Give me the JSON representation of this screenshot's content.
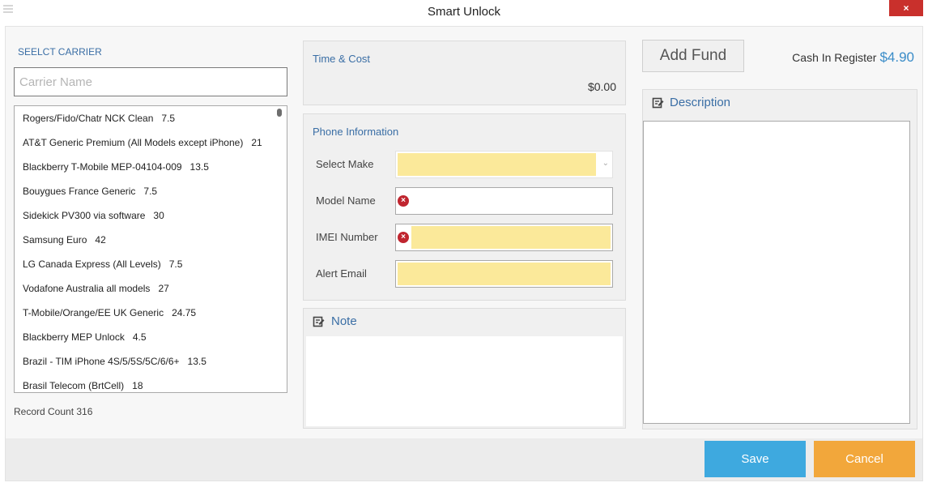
{
  "window": {
    "title": "Smart Unlock",
    "close_label": "×"
  },
  "carrier": {
    "heading": "SEELCT CARRIER",
    "search_placeholder": "Carrier Name",
    "items": [
      {
        "name": "Rogers/Fido/Chatr NCK Clean",
        "price": "7.5"
      },
      {
        "name": "AT&T Generic Premium (All Models except iPhone)",
        "price": "21"
      },
      {
        "name": "Blackberry T-Mobile  MEP-04104-009",
        "price": "13.5"
      },
      {
        "name": "Bouygues France Generic",
        "price": "7.5"
      },
      {
        "name": "Sidekick PV300 via software",
        "price": "30"
      },
      {
        "name": "Samsung Euro",
        "price": "42"
      },
      {
        "name": "LG Canada Express (All Levels)",
        "price": "7.5"
      },
      {
        "name": "Vodafone Australia all models",
        "price": "27"
      },
      {
        "name": "T-Mobile/Orange/EE UK Generic",
        "price": "24.75"
      },
      {
        "name": "Blackberry MEP Unlock",
        "price": "4.5"
      },
      {
        "name": "Brazil - TIM iPhone 4S/5/5S/5C/6/6+",
        "price": "13.5"
      },
      {
        "name": "Brasil Telecom (BrtCell)",
        "price": "18"
      }
    ],
    "record_count": "Record Count 316"
  },
  "time_cost": {
    "title": "Time & Cost",
    "cost": "$0.00"
  },
  "phone_info": {
    "title": "Phone Information",
    "select_make_label": "Select Make",
    "model_name_label": "Model Name",
    "imei_label": "IMEI Number",
    "alert_email_label": "Alert Email"
  },
  "note": {
    "title": "Note"
  },
  "funds": {
    "add_fund_label": "Add Fund",
    "cash_label": "Cash In Register",
    "cash_amount": "$4.90"
  },
  "description": {
    "title": "Description"
  },
  "actions": {
    "save_label": "Save",
    "cancel_label": "Cancel"
  },
  "colors": {
    "accent": "#3a6ea5",
    "save": "#3ea9df",
    "cancel": "#f2a73b",
    "required_fill": "#fbe99a",
    "error": "#c0252f"
  }
}
